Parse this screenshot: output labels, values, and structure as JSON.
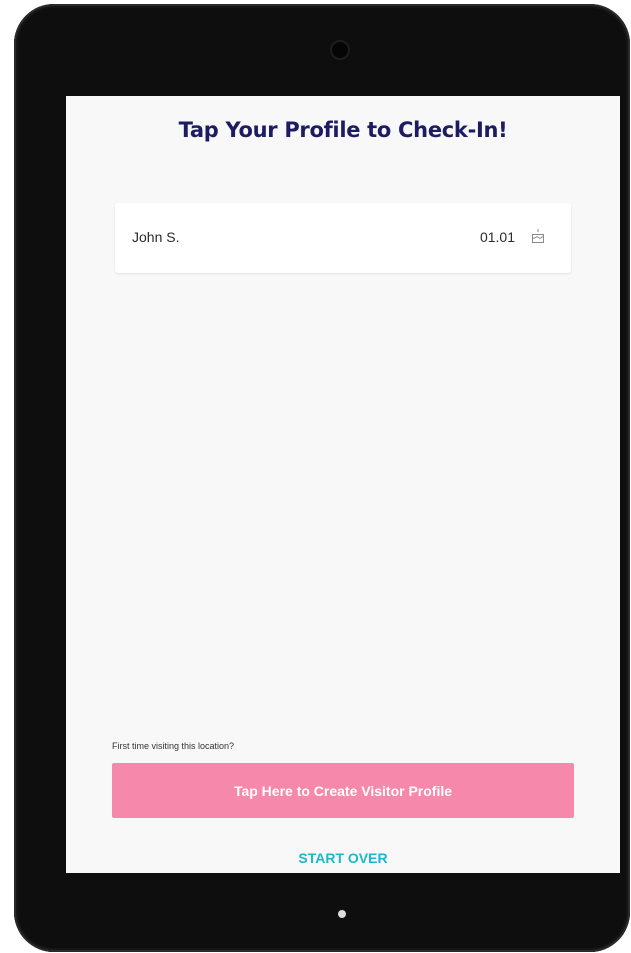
{
  "page": {
    "title": "Tap Your Profile to Check-In!"
  },
  "profiles": [
    {
      "name": "John S.",
      "birthday": "01.01",
      "icon": "birthday-cake-icon"
    }
  ],
  "footer": {
    "first_time_label": "First time visiting this location?",
    "create_profile_label": "Tap Here to Create Visitor Profile",
    "start_over_label": "START OVER"
  },
  "colors": {
    "title": "#1d1c62",
    "create_button_bg": "#f688ab",
    "start_over": "#1bb8c9",
    "screen_bg": "#f8f8f8",
    "device_frame": "#0e0e0e"
  }
}
